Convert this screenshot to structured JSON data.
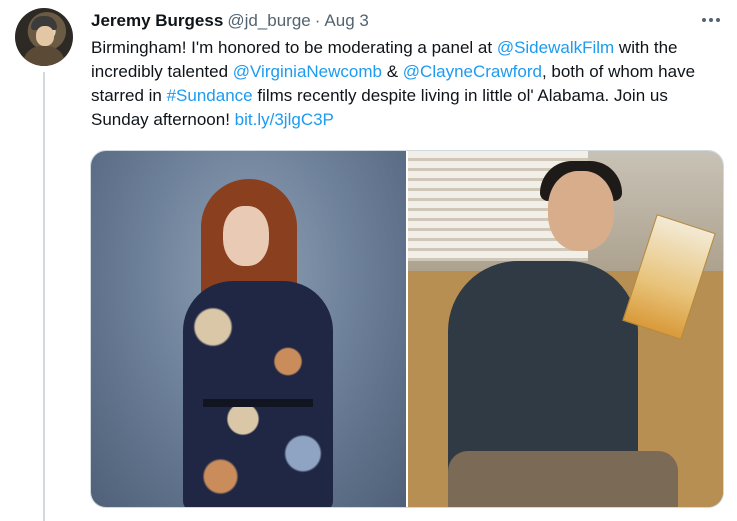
{
  "tweet": {
    "author_name": "Jeremy Burgess",
    "handle": "@jd_burge",
    "separator": "·",
    "date": "Aug 3",
    "text": {
      "t1": "Birmingham! I'm honored to be moderating a panel at ",
      "m1": "@SidewalkFilm",
      "t2": " with the incredibly talented ",
      "m2": "@VirginiaNewcomb",
      "t3": " & ",
      "m3": "@ClayneCrawford",
      "t4": ", both of whom have starred in ",
      "h1": "#Sundance",
      "t5": " films recently despite living in little ol' Alabama. Join us Sunday afternoon! ",
      "l1": "bit.ly/3jlgC3P"
    }
  },
  "icons": {
    "more": "more-horizontal-icon"
  },
  "colors": {
    "link": "#1d9bf0",
    "secondary_text": "#536471",
    "primary_text": "#0f1419",
    "divider": "#cfd9de"
  }
}
